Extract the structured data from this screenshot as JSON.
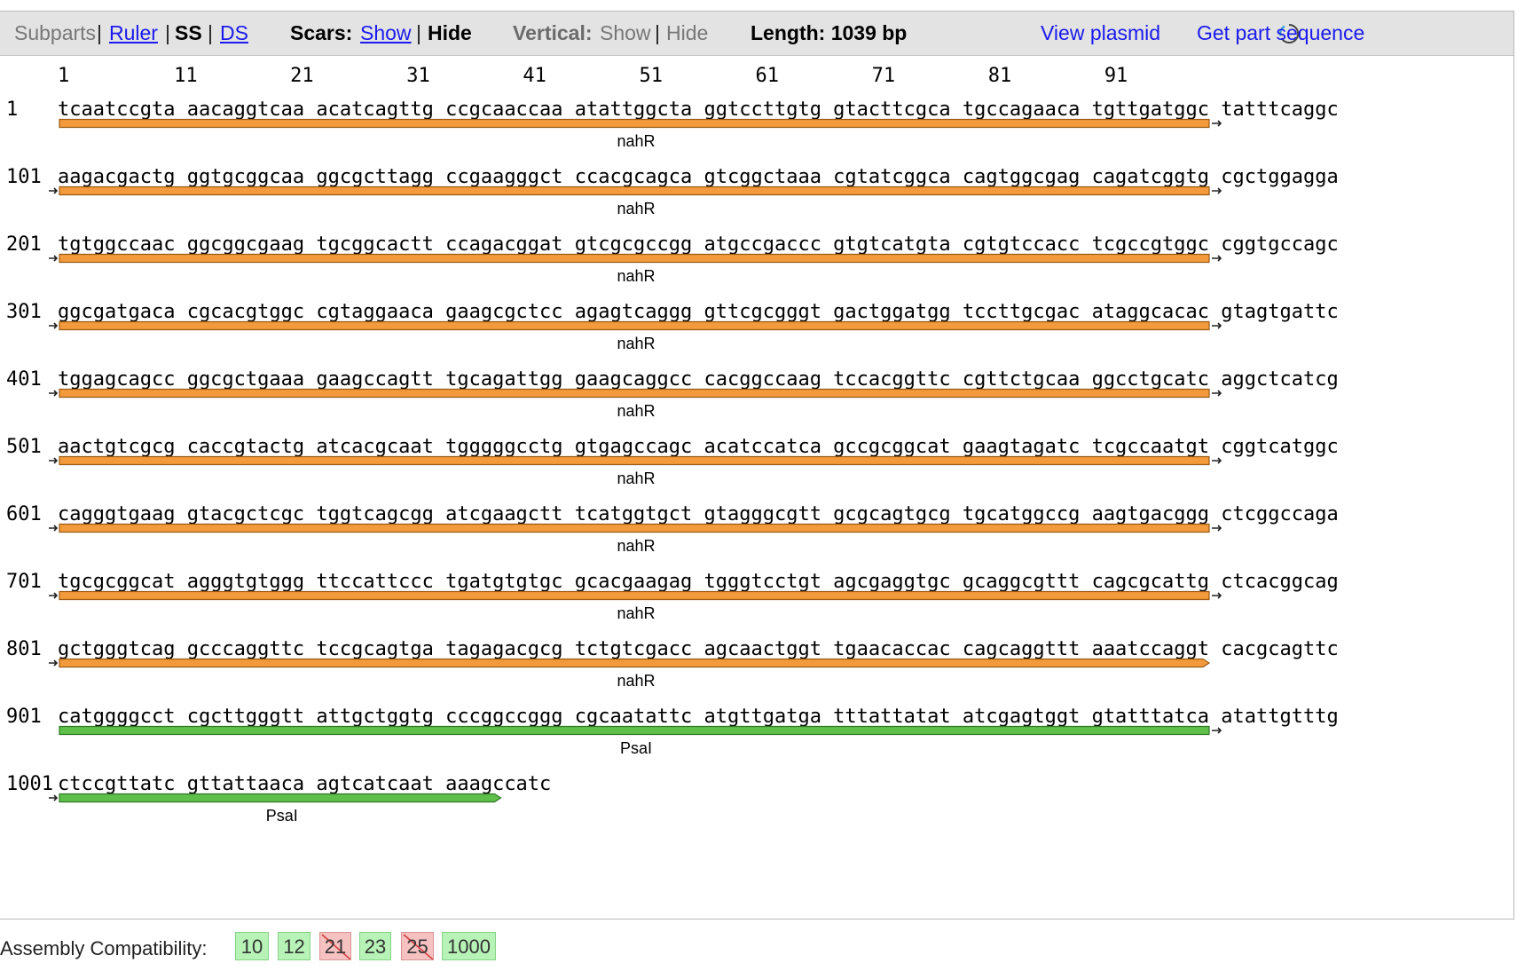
{
  "toolbar": {
    "subparts": "Subparts",
    "ruler": "Ruler",
    "ss": "SS",
    "ds": "DS",
    "scars_label": "Scars:",
    "scars_show": "Show",
    "scars_hide": "Hide",
    "vertical_label": "Vertical:",
    "vertical_show": "Show",
    "vertical_hide": "Hide",
    "length": "Length: 1039 bp",
    "view_plasmid": "View plasmid",
    "get_sequence": "Get part sequence",
    "sep": "|"
  },
  "ruler_ticks": [
    "1",
    "11",
    "21",
    "31",
    "41",
    "51",
    "61",
    "71",
    "81",
    "91"
  ],
  "rows": [
    {
      "num": "1",
      "seq": "tcaatccgta aacaggtcaa acatcagttg ccgcaaccaa atattggcta ggtccttgtg gtacttcgca tgccagaaca tgttgatggc tatttcaggc"
    },
    {
      "num": "101",
      "seq": "aagacgactg ggtgcggcaa ggcgcttagg ccgaagggct ccacgcagca gtcggctaaa cgtatcggca cagtggcgag cagatcggtg cgctggagga"
    },
    {
      "num": "201",
      "seq": "tgtggccaac ggcggcgaag tgcggcactt ccagacggat gtcgcgccgg atgccgaccc gtgtcatgta cgtgtccacc tcgccgtggc cggtgccagc"
    },
    {
      "num": "301",
      "seq": "ggcgatgaca cgcacgtggc cgtaggaaca gaagcgctcc agagtcaggg gttcgcgggt gactggatgg tccttgcgac ataggcacac gtagtgattc"
    },
    {
      "num": "401",
      "seq": "tggagcagcc ggcgctgaaa gaagccagtt tgcagattgg gaagcaggcc cacggccaag tccacggttc cgttctgcaa ggcctgcatc aggctcatcg"
    },
    {
      "num": "501",
      "seq": "aactgtcgcg caccgtactg atcacgcaat tgggggcctg gtgagccagc acatccatca gccgcggcat gaagtagatc tcgccaatgt cggtcatggc"
    },
    {
      "num": "601",
      "seq": "cagggtgaag gtacgctcgc tggtcagcgg atcgaagctt tcatggtgct gtagggcgtt gcgcagtgcg tgcatggccg aagtgacggg ctcggccaga"
    },
    {
      "num": "701",
      "seq": "tgcgcggcat agggtgtggg ttccattccc tgatgtgtgc gcacgaagag tgggtcctgt agcgaggtgc gcaggcgttt cagcgcattg ctcacggcag"
    },
    {
      "num": "801",
      "seq": "gctgggtcag gcccaggttc tccgcagtga tagagacgcg tctgtcgacc agcaactggt tgaacaccac cagcaggttt aaatccaggt cacgcagttc"
    },
    {
      "num": "901",
      "seq": "catggggcct cgcttgggtt attgctggtg cccggccggg cgcaatattc atgttgatga tttattatat atcgagtggt gtatttatca atattgtttg"
    },
    {
      "num": "1001",
      "seq": "ctccgttatc gttattaaca agtcatcaat aaagccatc"
    }
  ],
  "features": [
    {
      "label": "nahR",
      "color": "#f39b3c",
      "stroke": "#9a5a14"
    },
    {
      "label": "nahR",
      "color": "#f39b3c",
      "stroke": "#9a5a14"
    },
    {
      "label": "nahR",
      "color": "#f39b3c",
      "stroke": "#9a5a14"
    },
    {
      "label": "nahR",
      "color": "#f39b3c",
      "stroke": "#9a5a14"
    },
    {
      "label": "nahR",
      "color": "#f39b3c",
      "stroke": "#9a5a14"
    },
    {
      "label": "nahR",
      "color": "#f39b3c",
      "stroke": "#9a5a14"
    },
    {
      "label": "nahR",
      "color": "#f39b3c",
      "stroke": "#9a5a14"
    },
    {
      "label": "nahR",
      "color": "#f39b3c",
      "stroke": "#9a5a14"
    },
    {
      "label": "nahR",
      "color": "#f39b3c",
      "stroke": "#9a5a14"
    },
    {
      "label": "PsaI",
      "color": "#5ec04a",
      "stroke": "#2e7a22"
    },
    {
      "label": "PsaI",
      "color": "#5ec04a",
      "stroke": "#2e7a22"
    }
  ],
  "assembly": {
    "label": "Assembly Compatibility:",
    "standards": [
      {
        "name": "10",
        "compatible": true
      },
      {
        "name": "12",
        "compatible": true
      },
      {
        "name": "21",
        "compatible": false
      },
      {
        "name": "23",
        "compatible": true
      },
      {
        "name": "25",
        "compatible": false
      },
      {
        "name": "1000",
        "compatible": true
      }
    ]
  }
}
